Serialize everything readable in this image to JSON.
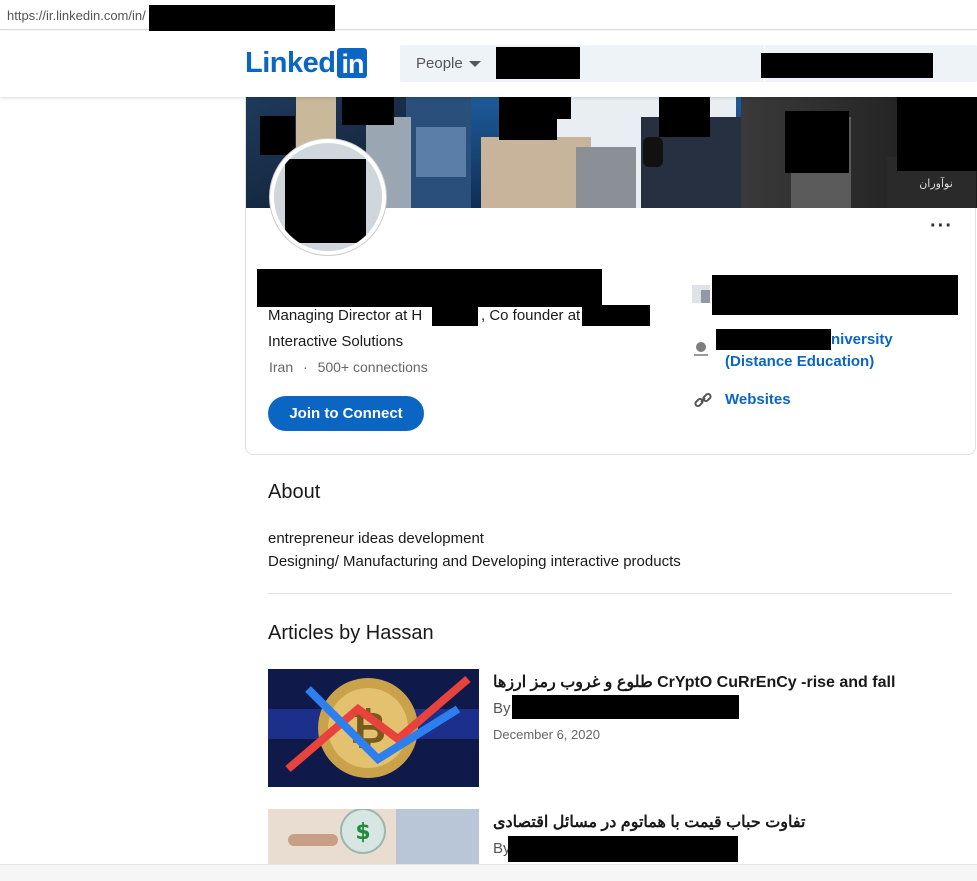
{
  "browser": {
    "url": "https://ir.linkedin.com/in/"
  },
  "header": {
    "logo_word": "Linked",
    "logo_in": "in",
    "search_filter": "People"
  },
  "profile": {
    "headline_line1": "Managing Director at H",
    "headline_mid": ", Co founder at",
    "headline_line2": "Interactive Solutions",
    "location": "Iran",
    "separator": "·",
    "connections": "500+ connections",
    "join_button": "Join to Connect",
    "more_menu": "···",
    "education_suffix": "niversity",
    "education_line2": "(Distance Education)",
    "websites_link": "Websites"
  },
  "about": {
    "title": "About",
    "lines": [
      "entrepreneur ideas development",
      "Designing/ Manufacturing and Developing interactive products"
    ]
  },
  "articles": {
    "title": "Articles by Hassan",
    "items": [
      {
        "title": "طلوع و غروب رمز ارزها CrYptO CuRrEnCy -rise and fall",
        "by": "By",
        "date": "December 6, 2020"
      },
      {
        "title": "تفاوت حباب قیمت با هماتوم در مسائل اقتصادی",
        "by": "By",
        "date": ""
      }
    ]
  },
  "colors": {
    "brand": "#0a66c2",
    "redaction": "#000000"
  }
}
